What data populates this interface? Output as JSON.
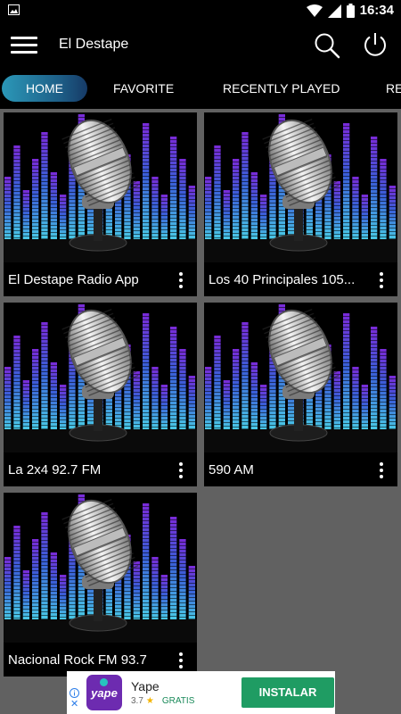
{
  "status_bar": {
    "time": "16:34",
    "icons": [
      "image-icon",
      "wifi-icon",
      "signal-icon",
      "battery-icon"
    ]
  },
  "app_bar": {
    "title": "El Destape",
    "icons": [
      "menu-icon",
      "search-icon",
      "power-icon"
    ]
  },
  "tabs": [
    {
      "label": "HOME",
      "active": true
    },
    {
      "label": "FAVORITE",
      "active": false
    },
    {
      "label": "RECENTLY PLAYED",
      "active": false
    },
    {
      "label": "RE",
      "active": false
    }
  ],
  "stations": [
    {
      "name": "El Destape Radio App"
    },
    {
      "name": "Los 40 Principales 105..."
    },
    {
      "name": "La 2x4 92.7 FM"
    },
    {
      "name": "590 AM"
    },
    {
      "name": "Nacional Rock FM 93.7"
    }
  ],
  "ad": {
    "app_name": "Yape",
    "logo_text": "yape",
    "rating": "3.7",
    "star": "★",
    "price": "GRATIS",
    "cta": "INSTALAR",
    "close": "✕"
  },
  "colors": {
    "bar_background": "#000000",
    "page_background": "#616161",
    "tab_active_start": "#2b98b8",
    "tab_active_end": "#163a66",
    "install_button": "#1f9c63",
    "ad_logo": "#6d2bb0"
  }
}
